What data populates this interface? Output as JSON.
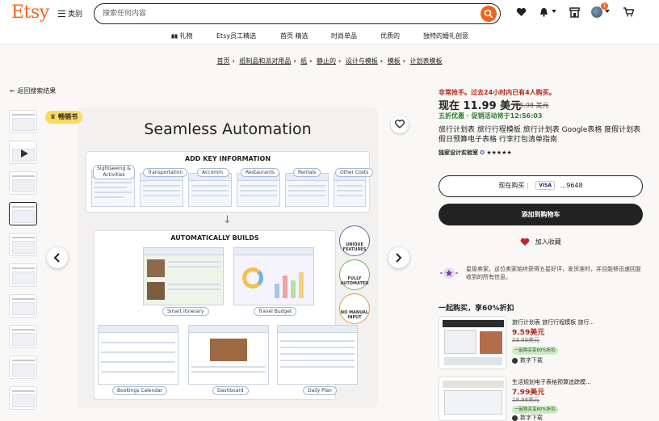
{
  "header": {
    "logo": "Etsy",
    "categories_label": "类别",
    "search_placeholder": "搜索任何内容",
    "cart_badge": "1"
  },
  "nav": {
    "items": [
      "礼物",
      "Etsy员工精选",
      "首页 精选",
      "时尚单品",
      "优质的",
      "独特的婚礼创意"
    ]
  },
  "breadcrumb": [
    "首页",
    "纸制品和派对用品",
    "纸",
    "静止的",
    "设计与模板",
    "模板",
    "计划表模板"
  ],
  "back_link": "返回搜索结果",
  "gallery": {
    "badge": "畅销书",
    "image": {
      "title": "Seamless Automation",
      "section1": "ADD KEY INFORMATION",
      "section2": "AUTOMATICALLY BUILDS",
      "labels_top": [
        "Sightseeing & Activities",
        "Transportation",
        "Accomm.",
        "Restaurants",
        "Rentals",
        "Other Costs"
      ],
      "labels_bottom": [
        "Smart Itinerary",
        "Travel Budget",
        "Bookings Calendar",
        "Dashboard",
        "Daily Plan"
      ],
      "features": [
        "UNIQUE FEATURES",
        "FULLY AUTOMATED",
        "NO MANUAL INPUT"
      ]
    }
  },
  "product": {
    "urgency": "非常抢手。过去24小时内已有4人购买。",
    "price": "现在 11.99 美元",
    "old_price": "23.98 美元",
    "discount": "五折优惠 · 促销活动将于12:56:03",
    "title": "旅行计划表 旅行行程模板 旅行计划表 Google表格 度假计划表 假日预算电子表格 行李打包清单指南",
    "shop": "独家设计实验室",
    "rating": "★★★★★",
    "buy_now": "现在购买",
    "card_brand": "VISA",
    "card_last": "...9648",
    "add_to_cart": "添加到购物车",
    "add_fav": "加入收藏",
    "star_seller": "星级卖家。这位卖家始终获得五星好评，发货准时，并且能够迅速回复收到的所有信息。"
  },
  "bundle": {
    "heading": "一起购买，享60%折扣",
    "items": [
      {
        "title": "旅行计划表 旅行行程模板 旅行...",
        "price": "9.59美元",
        "old": "23.98美元",
        "tag": "一起购买享60%折扣",
        "type": "数字下载"
      },
      {
        "title": "生活规划电子表格预算追踪模...",
        "price": "7.99美元",
        "old": "19.98美元",
        "tag": "一起购买享60%折扣",
        "type": "数字下载"
      }
    ]
  },
  "colors": {
    "brand": "#f1641e",
    "urgent": "#b0281a",
    "discount": "#2e7d32"
  }
}
